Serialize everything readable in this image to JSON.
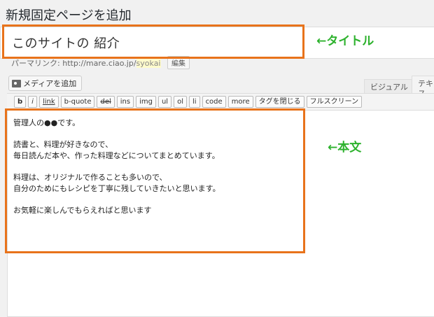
{
  "page": {
    "title": "新規固定ページを追加"
  },
  "title_field": {
    "value": "このサイトの 紹介"
  },
  "annotations": {
    "title_label": "←タイトル",
    "body_label": "←本文"
  },
  "permalink": {
    "label": "パーマリンク:",
    "url": "http://mare.ciao.jp/",
    "slug": "syokai",
    "edit_label": "編集"
  },
  "media_button": {
    "label": "メディアを追加"
  },
  "editor_tabs": {
    "visual": "ビジュアル",
    "text": "テキス"
  },
  "quicktags": [
    "b",
    "i",
    "link",
    "b-quote",
    "del",
    "ins",
    "img",
    "ul",
    "ol",
    "li",
    "code",
    "more",
    "タグを閉じる",
    "フルスクリーン"
  ],
  "body": {
    "line1": "管理人の●●です。",
    "line2": "読書と、料理が好きなので、",
    "line3": "毎日読んだ本や、作った料理などについてまとめています。",
    "line4": "料理は、オリジナルで作ることも多いので、",
    "line5": "自分のためにもレシピを丁寧に残していきたいと思います。",
    "line6": "お気軽に楽しんでもらえればと思います"
  },
  "colors": {
    "highlight": "#e8731b",
    "annotation": "#2db22d"
  }
}
